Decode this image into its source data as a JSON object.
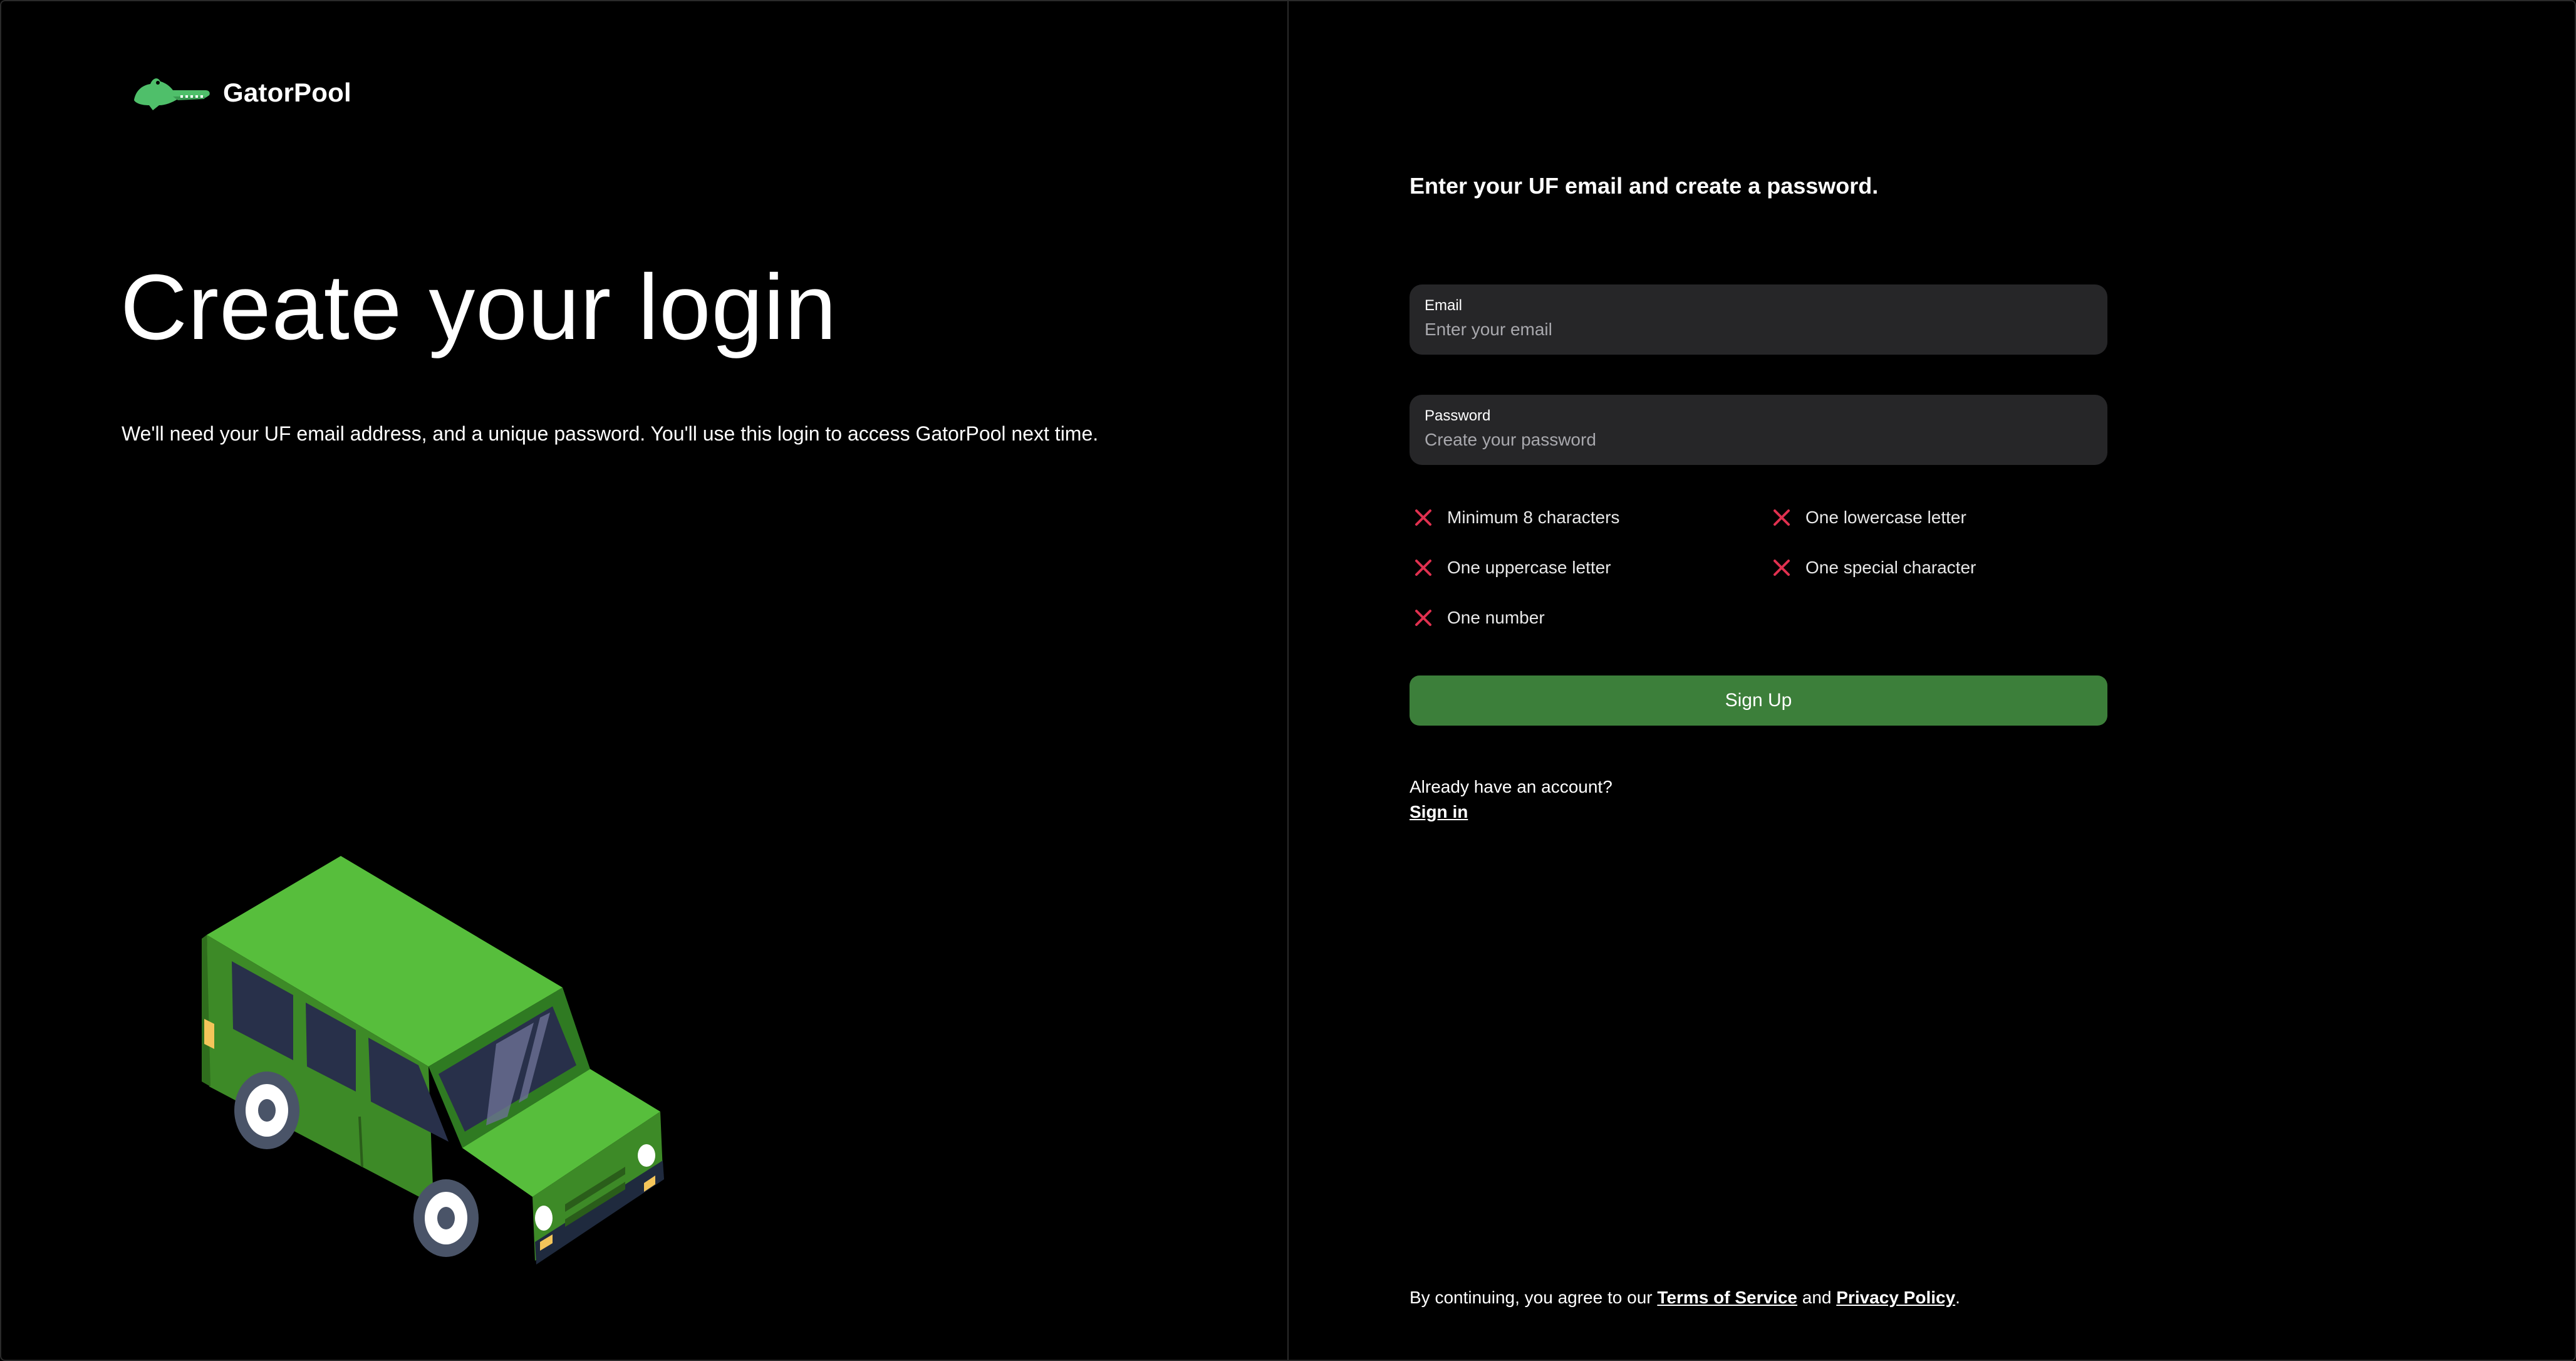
{
  "brand": {
    "name": "GatorPool",
    "logo_icon": "alligator-icon",
    "logo_color": "#4fbf6a"
  },
  "hero": {
    "title": "Create your login",
    "subtitle": "We'll need your UF email address, and a unique password. You'll use this login to access GatorPool next time.",
    "illustration": "green-van-illustration"
  },
  "form": {
    "heading": "Enter your UF email and create a password.",
    "email": {
      "label": "Email",
      "placeholder": "Enter your email",
      "value": ""
    },
    "password": {
      "label": "Password",
      "placeholder": "Create your password",
      "value": ""
    },
    "requirements": [
      {
        "label": "Minimum 8 characters",
        "met": false
      },
      {
        "label": "One lowercase letter",
        "met": false
      },
      {
        "label": "One uppercase letter",
        "met": false
      },
      {
        "label": "One special character",
        "met": false
      },
      {
        "label": "One number",
        "met": false
      }
    ],
    "submit_label": "Sign Up",
    "already_text": "Already have an account?",
    "signin_label": "Sign in"
  },
  "legal": {
    "prefix": "By continuing, you agree to our ",
    "terms_label": "Terms of Service",
    "and": " and ",
    "privacy_label": "Privacy Policy",
    "suffix": "."
  },
  "colors": {
    "background": "#000000",
    "field_bg": "#262628",
    "button_green": "#3c7f3a",
    "requirement_fail": "#e0304f",
    "van_green": "#54bb3a"
  }
}
